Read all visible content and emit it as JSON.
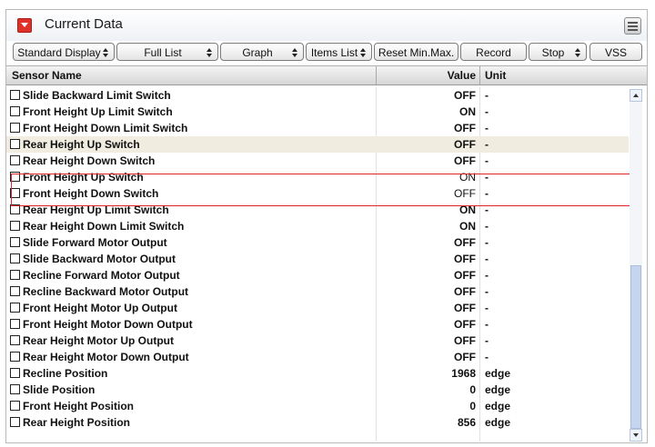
{
  "window": {
    "title": "Current Data"
  },
  "toolbar": {
    "buttons": [
      {
        "label": "Standard Display",
        "dropdown": true
      },
      {
        "label": "Full List",
        "dropdown": true
      },
      {
        "label": "Graph",
        "dropdown": true
      },
      {
        "label": "Items List",
        "dropdown": true
      },
      {
        "label": "Reset Min.Max.",
        "dropdown": false
      },
      {
        "label": "Record",
        "dropdown": false
      },
      {
        "label": "Stop",
        "dropdown": true
      },
      {
        "label": "VSS",
        "dropdown": false
      }
    ]
  },
  "table": {
    "columns": {
      "name": "Sensor Name",
      "value": "Value",
      "unit": "Unit"
    },
    "rows": [
      {
        "name": "Slide Backward Limit Switch",
        "value": "OFF",
        "unit": "-"
      },
      {
        "name": "Front Height Up Limit Switch",
        "value": "ON",
        "unit": "-"
      },
      {
        "name": "Front Height Down Limit Switch",
        "value": "OFF",
        "unit": "-"
      },
      {
        "name": "Rear Height Up Switch",
        "value": "OFF",
        "unit": "-",
        "highlighted": true
      },
      {
        "name": "Rear Height Down Switch",
        "value": "OFF",
        "unit": "-"
      },
      {
        "name": "Front Height Up Switch",
        "value": "ON",
        "unit": "-",
        "boxed": true
      },
      {
        "name": "Front Height Down Switch",
        "value": "OFF",
        "unit": "-",
        "boxed": true
      },
      {
        "name": "Rear Height Up Limit Switch",
        "value": "ON",
        "unit": "-"
      },
      {
        "name": "Rear Height Down Limit Switch",
        "value": "ON",
        "unit": "-"
      },
      {
        "name": "Slide Forward Motor Output",
        "value": "OFF",
        "unit": "-"
      },
      {
        "name": "Slide Backward Motor Output",
        "value": "OFF",
        "unit": "-"
      },
      {
        "name": "Recline Forward Motor Output",
        "value": "OFF",
        "unit": "-"
      },
      {
        "name": "Recline Backward Motor Output",
        "value": "OFF",
        "unit": "-"
      },
      {
        "name": "Front Height Motor Up Output",
        "value": "OFF",
        "unit": "-"
      },
      {
        "name": "Front Height Motor Down Output",
        "value": "OFF",
        "unit": "-"
      },
      {
        "name": "Rear Height Motor Up Output",
        "value": "OFF",
        "unit": "-"
      },
      {
        "name": "Rear Height Motor Down Output",
        "value": "OFF",
        "unit": "-"
      },
      {
        "name": "Recline Position",
        "value": "1968",
        "unit": "edge"
      },
      {
        "name": "Slide Position",
        "value": "0",
        "unit": "edge"
      },
      {
        "name": "Front Height Position",
        "value": "0",
        "unit": "edge"
      },
      {
        "name": "Rear Height Position",
        "value": "856",
        "unit": "edge"
      }
    ]
  },
  "scrollbar": {
    "position_fraction": 0.5
  },
  "colors": {
    "accent_red": "#e0302a",
    "highlight_row": "#f0ede0",
    "selection_box": "#d9262b",
    "scrollbar_thumb": "#c6d5ee"
  },
  "icons": {
    "title": "collapse-icon",
    "menu": "menu-icon",
    "checkbox": "checkbox-icon"
  }
}
